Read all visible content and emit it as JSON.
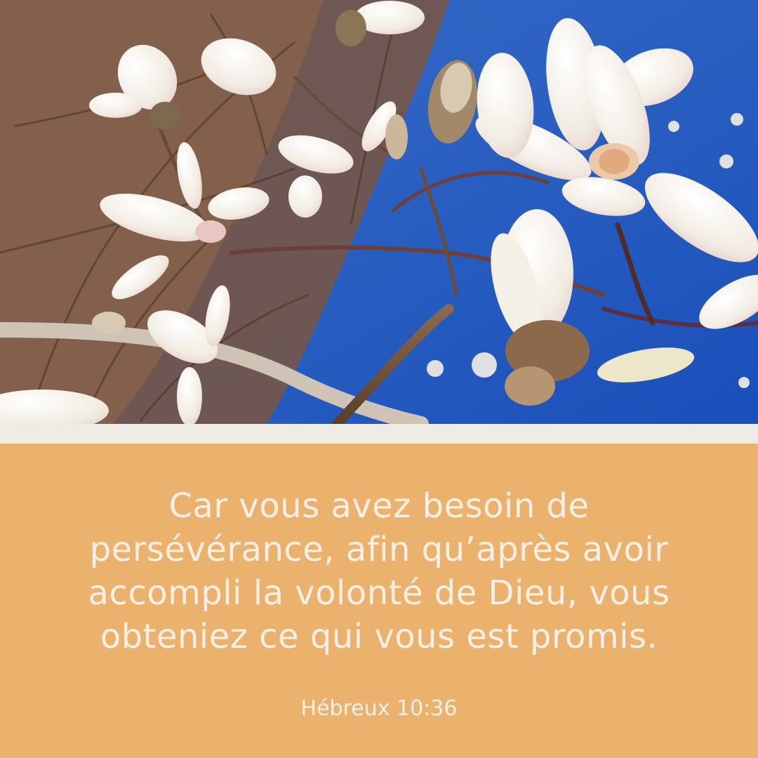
{
  "photo": {
    "subject": "magnolia-blossoms-against-blue-sky",
    "colors": {
      "sky": "#1f59c6",
      "branches": "#6b4a32",
      "petals": "#f4efe6",
      "petal_tint": "#e9c9c4"
    }
  },
  "quote": {
    "lines": [
      "Car vous avez besoin de",
      "persévérance, afin qu’après avoir",
      "accompli la volonté de Dieu, vous",
      "obteniez ce qui vous est promis."
    ],
    "reference": "Hébreux 10:36"
  },
  "colors": {
    "panel": "#ebb26e",
    "divider": "#efece6",
    "text": "#f7efe5"
  }
}
